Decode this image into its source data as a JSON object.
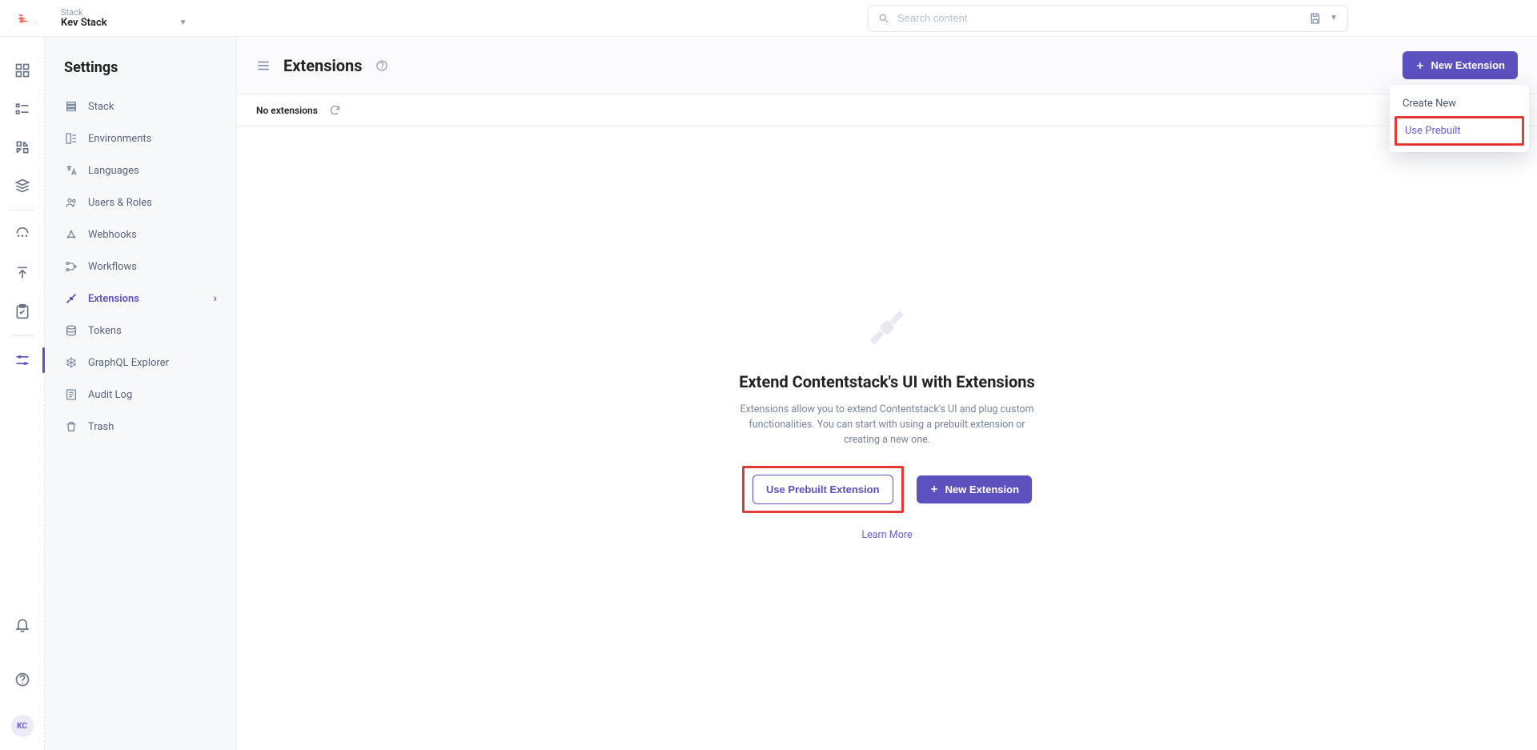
{
  "header": {
    "stack_label": "Stack",
    "stack_name": "Kev Stack",
    "search_placeholder": "Search content"
  },
  "rail": {
    "avatar_initials": "KC"
  },
  "sidebar": {
    "title": "Settings",
    "items": [
      {
        "label": "Stack"
      },
      {
        "label": "Environments"
      },
      {
        "label": "Languages"
      },
      {
        "label": "Users & Roles"
      },
      {
        "label": "Webhooks"
      },
      {
        "label": "Workflows"
      },
      {
        "label": "Extensions"
      },
      {
        "label": "Tokens"
      },
      {
        "label": "GraphQL Explorer"
      },
      {
        "label": "Audit Log"
      },
      {
        "label": "Trash"
      }
    ]
  },
  "page": {
    "title": "Extensions",
    "new_button": "New Extension",
    "sub_bar_text": "No extensions"
  },
  "dropdown": {
    "items": [
      {
        "label": "Create New"
      },
      {
        "label": "Use Prebuilt"
      }
    ]
  },
  "empty": {
    "heading": "Extend Contentstack's UI with Extensions",
    "body": "Extensions allow you to extend Contentstack's UI and plug custom functionalities. You can start with using a prebuilt extension or creating a new one.",
    "prebuilt_button": "Use Prebuilt Extension",
    "new_button": "New Extension",
    "learn_more": "Learn More"
  }
}
